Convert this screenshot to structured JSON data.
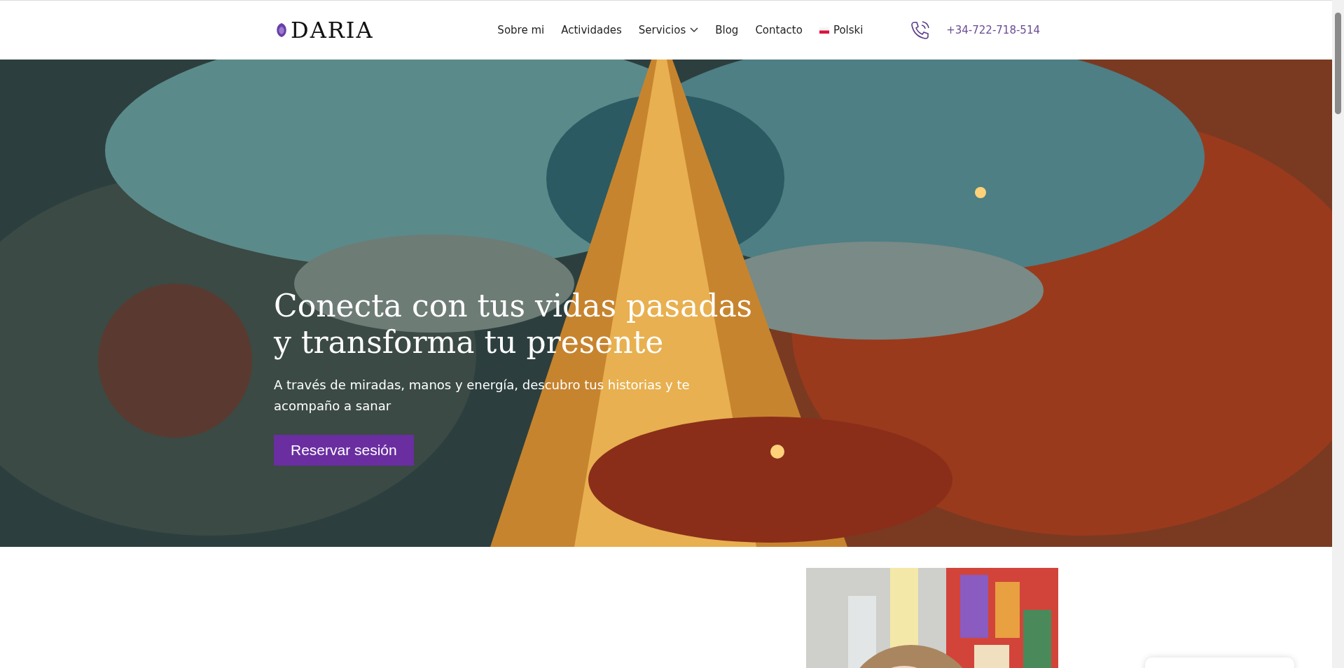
{
  "header": {
    "logo": "DARIA",
    "nav": [
      {
        "label": "Sobre mi",
        "kind": "link"
      },
      {
        "label": "Actividades",
        "kind": "link"
      },
      {
        "label": "Servicios",
        "kind": "dropdown"
      },
      {
        "label": "Blog",
        "kind": "link"
      },
      {
        "label": "Contacto",
        "kind": "link"
      },
      {
        "label": "Polski",
        "kind": "language"
      }
    ],
    "phone": "+34-722-718-514"
  },
  "hero": {
    "kind": "picture",
    "title_lines": [
      "Conecta con tus vidas pasadas",
      "y transforma tu presente"
    ],
    "subtitle": "A través de miradas, manos y energía, descubro tus historias y te acompaño a sanar",
    "button": "Reservar sesión"
  }
}
